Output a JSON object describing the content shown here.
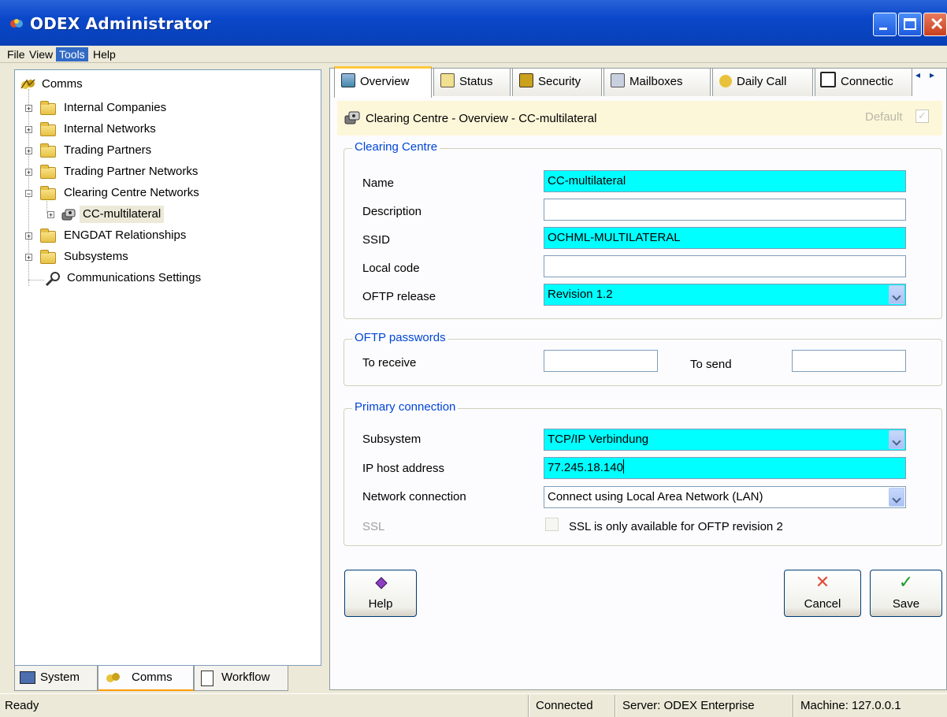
{
  "window": {
    "title": "ODEX Administrator"
  },
  "menu": [
    "File",
    "View",
    "Tools",
    "Help"
  ],
  "tree": {
    "root": "Comms",
    "items": [
      "Internal Companies",
      "Internal Networks",
      "Trading Partners",
      "Trading Partner Networks",
      "Clearing Centre Networks",
      "CC-multilateral",
      "ENGDAT Relationships",
      "Subsystems",
      "Communications Settings"
    ]
  },
  "bottom_tabs": [
    "System",
    "Comms",
    "Workflow"
  ],
  "tabs": [
    "Overview",
    "Status",
    "Security",
    "Mailboxes",
    "Daily Call",
    "Connectic"
  ],
  "header": {
    "title": "Clearing Centre - Overview - CC-multilateral",
    "default_label": "Default"
  },
  "clearing_centre": {
    "legend": "Clearing Centre",
    "name_label": "Name",
    "name_value": "CC-multilateral",
    "description_label": "Description",
    "description_value": "",
    "ssid_label": "SSID",
    "ssid_value": "OCHML-MULTILATERAL",
    "local_code_label": "Local code",
    "local_code_value": "",
    "oftp_release_label": "OFTP release",
    "oftp_release_value": "Revision 1.2"
  },
  "passwords": {
    "legend": "OFTP passwords",
    "receive_label": "To receive",
    "receive_value": "",
    "send_label": "To send",
    "send_value": ""
  },
  "primary": {
    "legend": "Primary connection",
    "subsystem_label": "Subsystem",
    "subsystem_value": "TCP/IP Verbindung",
    "ip_label": "IP host address",
    "ip_value": "77.245.18.140",
    "network_label": "Network connection",
    "network_value": "Connect using Local Area Network (LAN)",
    "ssl_label": "SSL",
    "ssl_text": "SSL is only available for OFTP revision 2"
  },
  "buttons": {
    "help": "Help",
    "cancel": "Cancel",
    "save": "Save"
  },
  "status": {
    "ready": "Ready",
    "connected": "Connected",
    "server": "Server: ODEX Enterprise",
    "machine": "Machine: 127.0.0.1"
  },
  "colors": {
    "title_blue": "#0a47c9",
    "required_field": "#00ffff",
    "legend_blue": "#0046d5",
    "tab_highlight": "#ffc83c"
  }
}
